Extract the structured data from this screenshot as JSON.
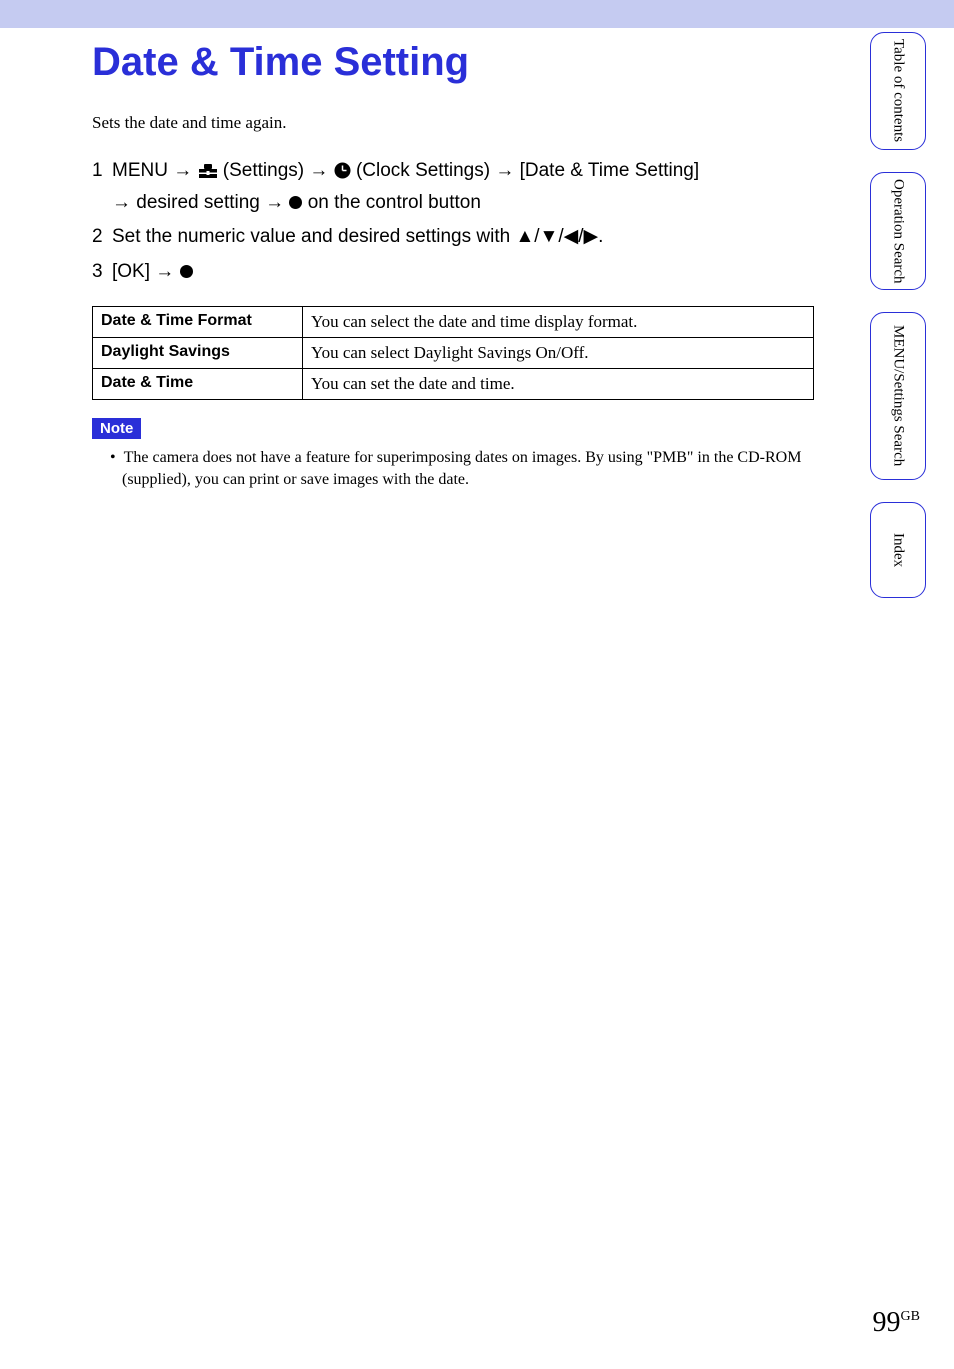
{
  "title": "Date & Time Setting",
  "intro": "Sets the date and time again.",
  "steps": {
    "s1": {
      "num": "1",
      "menu": "MENU",
      "arrow": "→",
      "settings_label": " (Settings) ",
      "clock_label": " (Clock Settings) ",
      "bracket": "[Date & Time Setting]",
      "desired": "desired setting ",
      "on_button": " on the control button"
    },
    "s2": {
      "num": "2",
      "text": "Set the numeric value and desired settings with ",
      "arrows": "▲/▼/◀/▶",
      "suffix": "."
    },
    "s3": {
      "num": "3",
      "ok": "[OK] ",
      "arrow": "→"
    }
  },
  "table": {
    "rows": [
      {
        "label": "Date & Time Format",
        "desc": "You can select the date and time display format."
      },
      {
        "label": "Daylight Savings",
        "desc": "You can select Daylight Savings On/Off."
      },
      {
        "label": "Date & Time",
        "desc": "You can set the date and time."
      }
    ]
  },
  "note": {
    "label": "Note",
    "items": [
      "The camera does not have a feature for superimposing dates on images. By using \"PMB\" in the CD-ROM (supplied), you can print or save images with the date."
    ]
  },
  "sidebar": {
    "t1": "Table of\ncontents",
    "t2": "Operation\nSearch",
    "t3": "MENU/Settings\nSearch",
    "t4": "Index"
  },
  "page_number": "99",
  "page_suffix": "GB"
}
